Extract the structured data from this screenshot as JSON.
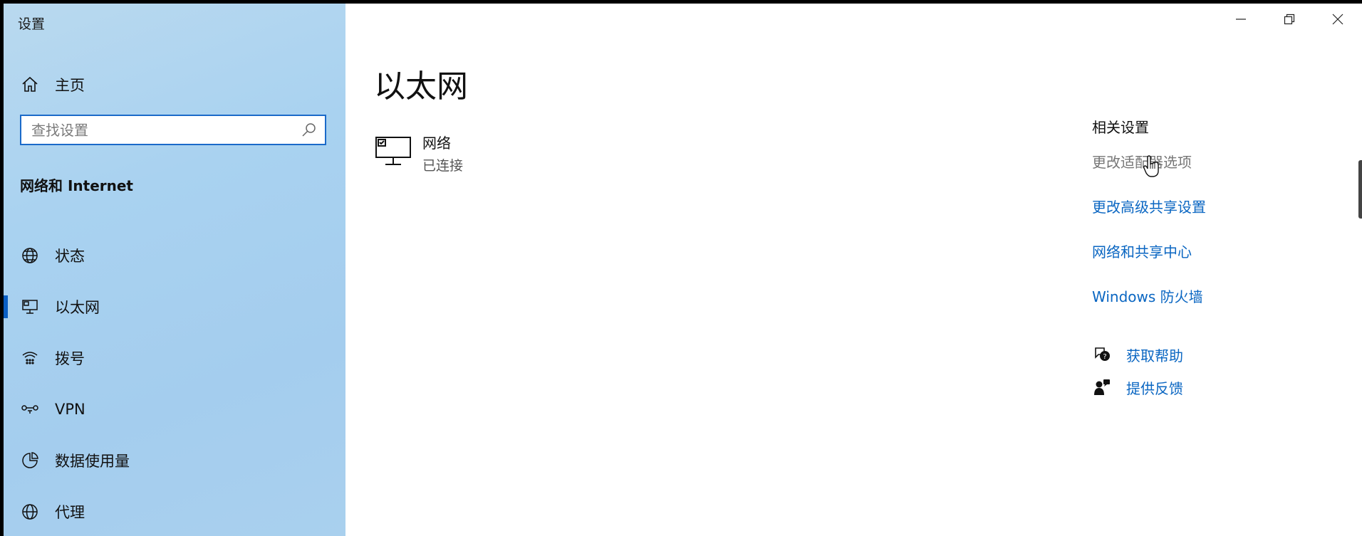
{
  "window": {
    "title": "设置"
  },
  "sidebar": {
    "home_label": "主页",
    "search": {
      "placeholder": "查找设置"
    },
    "section_title": "网络和 Internet",
    "items": [
      {
        "label": "状态",
        "icon": "globe-status-icon"
      },
      {
        "label": "以太网",
        "icon": "ethernet-icon",
        "active": true
      },
      {
        "label": "拨号",
        "icon": "dialup-icon"
      },
      {
        "label": "VPN",
        "icon": "vpn-icon"
      },
      {
        "label": "数据使用量",
        "icon": "data-usage-icon"
      },
      {
        "label": "代理",
        "icon": "globe-icon"
      }
    ]
  },
  "main": {
    "title": "以太网",
    "network": {
      "name": "网络",
      "status": "已连接"
    }
  },
  "related": {
    "title": "相关设置",
    "links": [
      "更改适配器选项",
      "更改高级共享设置",
      "网络和共享中心",
      "Windows 防火墙"
    ]
  },
  "help": {
    "get_help": "获取帮助",
    "feedback": "提供反馈"
  },
  "colors": {
    "accent": "#0a66c2",
    "active_indicator": "#0a5fc4",
    "sidebar_bg": "#a9d2f0"
  }
}
